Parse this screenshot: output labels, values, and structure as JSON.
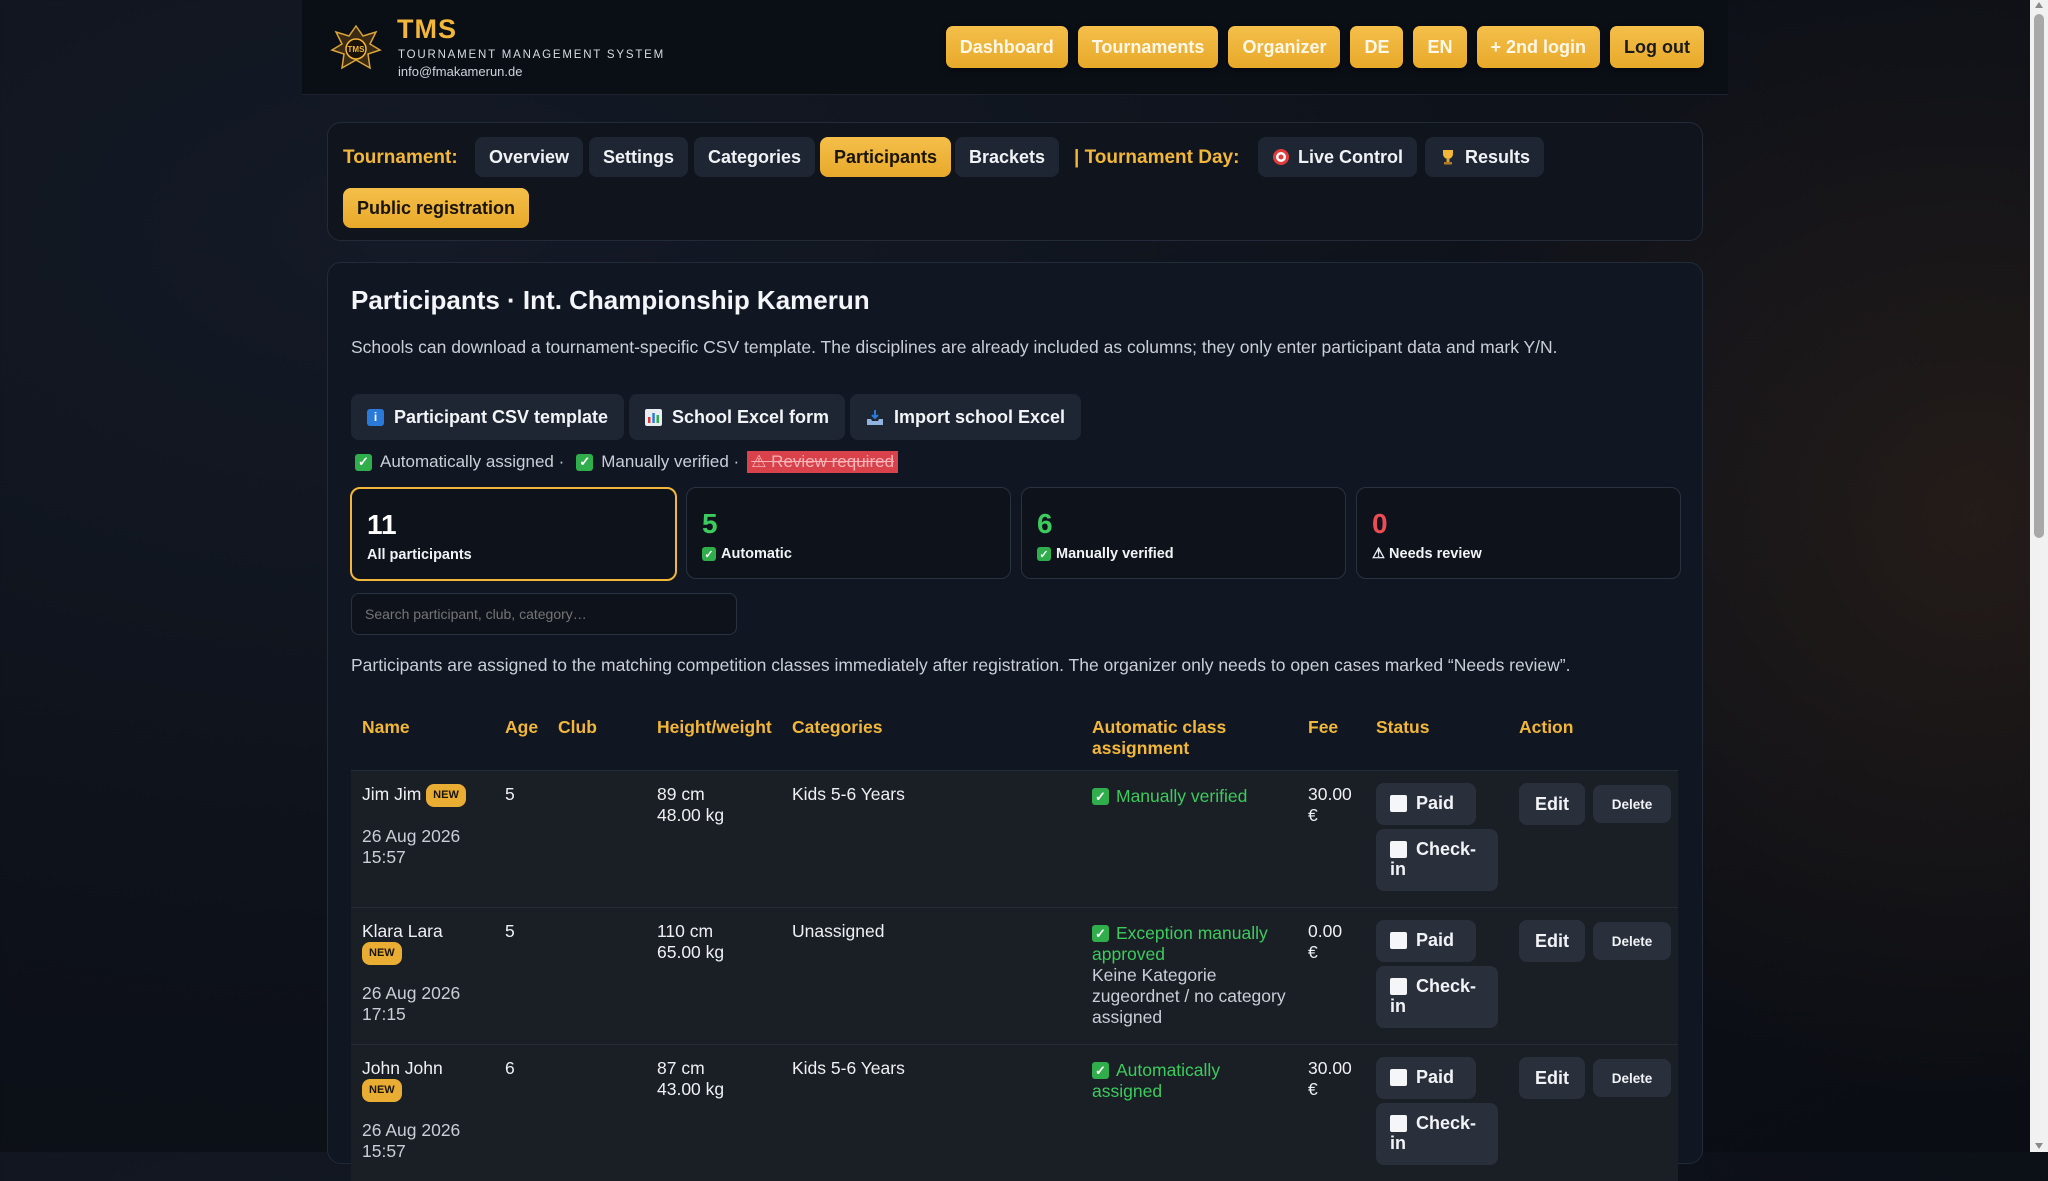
{
  "header": {
    "brand_title": "TMS",
    "brand_subtitle": "TOURNAMENT MANAGEMENT SYSTEM",
    "email": "info@fmakamerun.de",
    "logo_text": "TMS",
    "nav": [
      {
        "label": "Dashboard"
      },
      {
        "label": "Tournaments"
      },
      {
        "label": "Organizer"
      },
      {
        "label": "DE"
      },
      {
        "label": "EN"
      },
      {
        "label": "+ 2nd login"
      },
      {
        "label": "Log out"
      }
    ]
  },
  "tabs": {
    "tournament_label": "Tournament:",
    "overview": "Overview",
    "settings": "Settings",
    "categories": "Categories",
    "participants": "Participants",
    "brackets": "Brackets",
    "day_label": "| Tournament Day:",
    "live_control": "Live Control",
    "results": "Results",
    "public_registration": "Public registration"
  },
  "main": {
    "title": "Participants · Int. Championship Kamerun",
    "description": "Schools can download a tournament-specific CSV template. The disciplines are already included as columns; they only enter participant data and mark Y/N.",
    "actions": {
      "csv_template": "Participant CSV template",
      "excel_form": "School Excel form",
      "import_excel": "Import school Excel"
    },
    "legend": {
      "auto": "Automatically assigned ·",
      "manual": "Manually verified ·",
      "review": "⚠ Review required"
    },
    "stats": [
      {
        "value": "11",
        "label": "All participants",
        "color": "#ffffff"
      },
      {
        "value": "5",
        "label": "Automatic",
        "color": "#3ccb5d"
      },
      {
        "value": "6",
        "label": "Manually verified",
        "color": "#3ccb5d"
      },
      {
        "value": "0",
        "label": "⚠ Needs review",
        "color": "#ef4b55"
      }
    ],
    "search_placeholder": "Search participant, club, category…",
    "info": "Participants are assigned to the matching competition classes immediately after registration. The organizer only needs to open cases marked “Needs review”."
  },
  "table": {
    "headers": {
      "name": "Name",
      "age": "Age",
      "club": "Club",
      "height_weight": "Height/weight",
      "categories": "Categories",
      "auto_assignment_1": "Automatic class",
      "auto_assignment_2": "assignment",
      "fee": "Fee",
      "status": "Status",
      "action": "Action"
    },
    "badge": "NEW",
    "paid_label": "Paid",
    "checkin_label_1": "Check-",
    "checkin_label_2": "in",
    "edit_label": "Edit",
    "delete_label": "Delete",
    "rows": [
      {
        "name": "Jim Jim",
        "date": "26 Aug 2026",
        "time": "15:57",
        "age": "5",
        "height": "89 cm",
        "weight": "48.00 kg",
        "category": "Kids 5-6 Years",
        "assignment_1": "Manually verified",
        "assignment_2": "",
        "note_1": "",
        "note_2": "",
        "note_3": "",
        "fee_1": "30.00",
        "fee_2": "€"
      },
      {
        "name": "Klara Lara",
        "date": "26 Aug 2026",
        "time": "17:15",
        "age": "5",
        "height": "110 cm",
        "weight": "65.00 kg",
        "category": "Unassigned",
        "assignment_1": "Exception manually",
        "assignment_2": "approved",
        "note_1": "Keine Kategorie",
        "note_2": "zugeordnet / no category",
        "note_3": "assigned",
        "fee_1": "0.00",
        "fee_2": "€"
      },
      {
        "name": "John John",
        "date": "26 Aug 2026",
        "time": "15:57",
        "age": "6",
        "height": "87 cm",
        "weight": "43.00 kg",
        "category": "Kids 5-6 Years",
        "assignment_1": "Automatically",
        "assignment_2": "assigned",
        "note_1": "",
        "note_2": "",
        "note_3": "",
        "fee_1": "30.00",
        "fee_2": "€"
      }
    ]
  },
  "colors": {
    "accent": "#f2b73a",
    "success": "#3ccb5d",
    "danger": "#ef4b55",
    "background": "#0d1119"
  }
}
